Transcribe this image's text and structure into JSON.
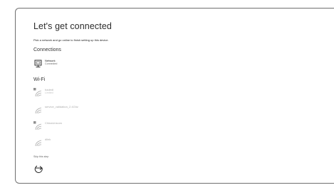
{
  "page": {
    "title": "Let's get connected",
    "subtitle": "Pick a network and go online to finish setting up this device."
  },
  "connections": {
    "heading": "Connections",
    "items": [
      {
        "name": "Network",
        "status": "Connected",
        "icon": "ethernet-icon"
      }
    ]
  },
  "wifi": {
    "heading": "Wi-Fi",
    "networks": [
      {
        "name": "hadedl",
        "status": "Limited",
        "icon": "wifi-secured-icon"
      },
      {
        "name": "service_validation_2.4Ghz",
        "status": "",
        "icon": "wifi-icon"
      },
      {
        "name": "ChinaUnicom",
        "status": "",
        "icon": "wifi-secured-icon"
      },
      {
        "name": "dlink",
        "status": "",
        "icon": "wifi-icon"
      }
    ]
  },
  "footer": {
    "skip_label": "Skip this step",
    "back_icon": "back-arrow-icon"
  },
  "colors": {
    "text": "#2b2b2b",
    "muted": "#666666",
    "border": "#6f6f6f"
  }
}
